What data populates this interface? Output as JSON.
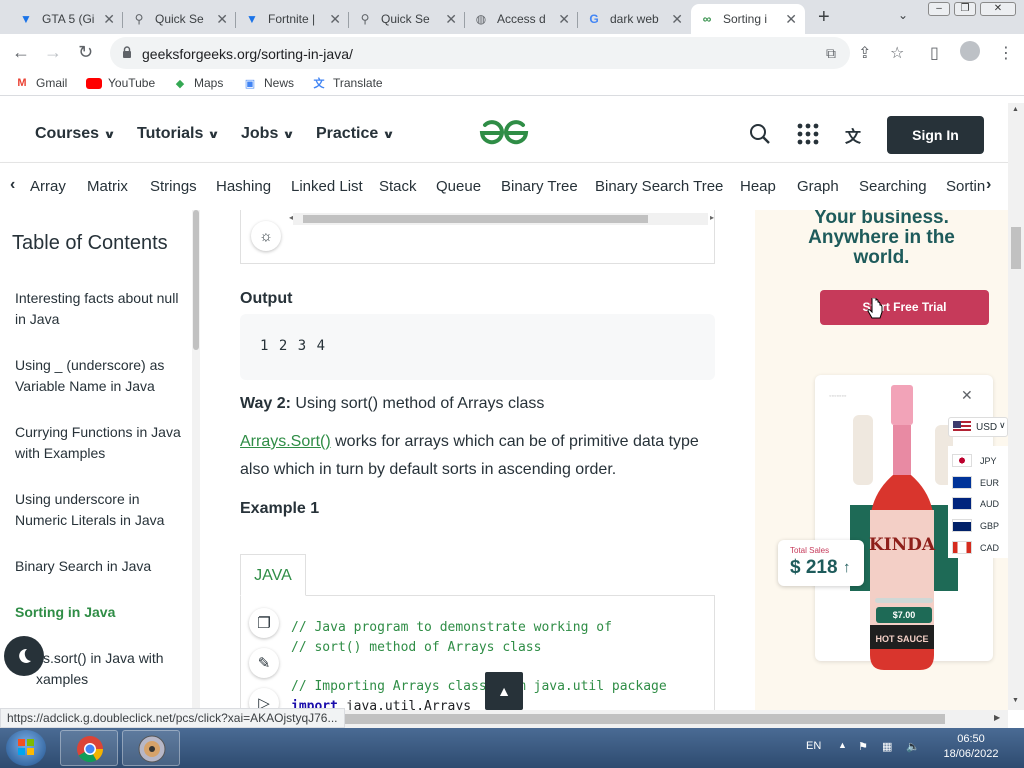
{
  "browser": {
    "tabs": [
      {
        "label": "GTA 5 (Gi",
        "icon": "v-icon",
        "color": "#1a73e8"
      },
      {
        "label": "Quick Se",
        "icon": "search-icon",
        "color": "#5f6368"
      },
      {
        "label": "Fortnite |",
        "icon": "v-icon",
        "color": "#1a73e8"
      },
      {
        "label": "Quick Se",
        "icon": "search-icon",
        "color": "#5f6368"
      },
      {
        "label": "Access d",
        "icon": "globe-icon",
        "color": "#5f6368"
      },
      {
        "label": "dark web",
        "icon": "google-icon",
        "color": "#4285f4"
      },
      {
        "label": "Sorting i",
        "icon": "gfg-icon",
        "color": "#2f8d46"
      }
    ],
    "url": "geeksforgeeks.org/sorting-in-java/",
    "bookmarks": [
      {
        "label": "Gmail",
        "icon": "gmail-icon"
      },
      {
        "label": "YouTube",
        "icon": "youtube-icon"
      },
      {
        "label": "Maps",
        "icon": "maps-icon"
      },
      {
        "label": "News",
        "icon": "news-icon"
      },
      {
        "label": "Translate",
        "icon": "translate-icon"
      }
    ],
    "status_url": "https://adclick.g.doubleclick.net/pcs/click?xai=AKAOjstyqJ76..."
  },
  "header": {
    "nav": [
      "Courses",
      "Tutorials",
      "Jobs",
      "Practice"
    ],
    "signin_label": "Sign In",
    "brand_color": "#2f8d46"
  },
  "topics": [
    "Array",
    "Matrix",
    "Strings",
    "Hashing",
    "Linked List",
    "Stack",
    "Queue",
    "Binary Tree",
    "Binary Search Tree",
    "Heap",
    "Graph",
    "Searching",
    "Sortin"
  ],
  "toc": {
    "title": "Table of Contents",
    "items": [
      {
        "label": "Interesting facts about null in Java",
        "active": false
      },
      {
        "label": "Using _ (underscore) as Variable Name in Java",
        "active": false
      },
      {
        "label": "Currying Functions in Java with Examples",
        "active": false
      },
      {
        "label": "Using underscore in Numeric Literals in Java",
        "active": false
      },
      {
        "label": "Binary Search in Java",
        "active": false
      },
      {
        "label": "Sorting in Java",
        "active": true
      },
      {
        "label": "ys.sort() in Java with xamples",
        "active": false
      }
    ]
  },
  "article": {
    "output_heading": "Output",
    "output_text": "1 2 3 4",
    "way2_bold": "Way 2:",
    "way2_text": " Using sort() method of Arrays class",
    "link_text": "Arrays.Sort()",
    "para_text": " works for arrays which can be of primitive data type also which in turn by default sorts in ascending order.",
    "example_heading": "Example 1",
    "lang_tab": "JAVA",
    "code": [
      {
        "kind": "comment",
        "text": "// Java program to demonstrate working of"
      },
      {
        "kind": "comment",
        "text": "// sort() method of Arrays class"
      },
      {
        "kind": "blank",
        "text": ""
      },
      {
        "kind": "comment",
        "text": "// Importing Arrays class from java.util package"
      },
      {
        "kind": "import",
        "keyword": "import",
        "text": " java.util.Arrays"
      }
    ]
  },
  "ad": {
    "headline": "Your business. Anywhere in the world.",
    "cta": "Start Free Trial",
    "total_sales_label": "Total Sales",
    "total_sales_value": "$ 218",
    "price": "$7.00",
    "bottle_label": "KINDA",
    "bottle_sub": "HOT SAUCE",
    "currency_selected": "USD",
    "currencies": [
      "JPY",
      "EUR",
      "AUD",
      "GBP",
      "CAD"
    ]
  },
  "taskbar": {
    "lang": "EN",
    "time": "06:50",
    "date": "18/06/2022"
  }
}
